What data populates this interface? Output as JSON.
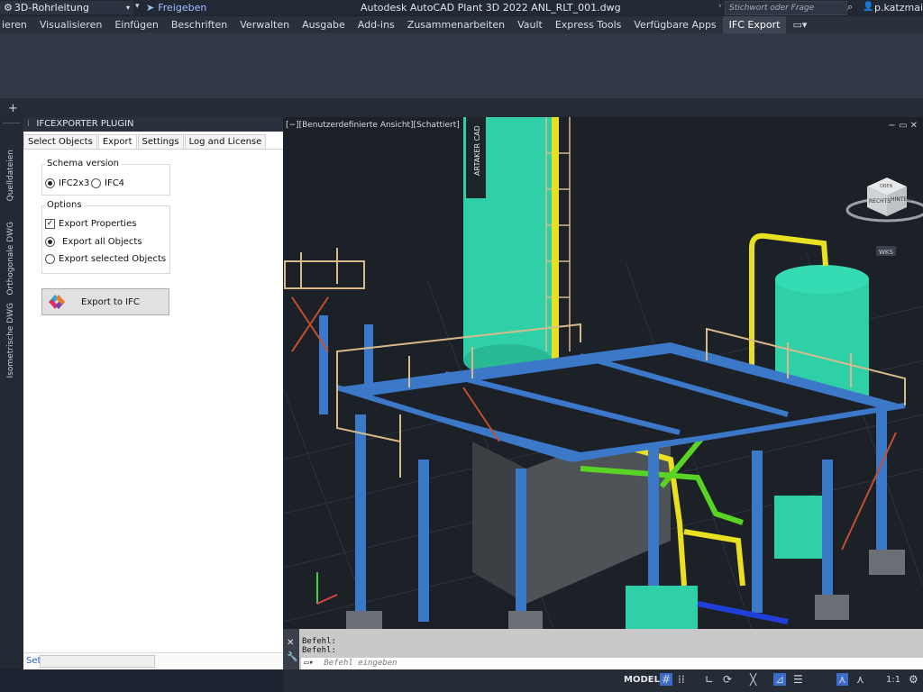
{
  "titlebar": {
    "workspace": "3D-Rohrleitung",
    "share": "Freigeben",
    "app_title": "Autodesk AutoCAD Plant 3D 2022   ANL_RLT_001.dwg",
    "search_placeholder": "Stichwort oder Frage eingeben",
    "user": "p.katzmaier@"
  },
  "ribbon": {
    "tabs": [
      "ieren",
      "Visualisieren",
      "Einfügen",
      "Beschriften",
      "Verwalten",
      "Ausgabe",
      "Add-ins",
      "Zusammenarbeiten",
      "Vault",
      "Express Tools",
      "Verfügbare Apps",
      "IFC Export"
    ],
    "active_tab": "IFC Export"
  },
  "side_tabs": [
    "Quelldateien",
    "Orthogonale DWG",
    "Isometrische DWG"
  ],
  "panel": {
    "title": "IFCEXPORTER PLUGIN",
    "tabs": [
      "Select Objects",
      "Export",
      "Settings",
      "Log and License"
    ],
    "active_tab": "Export",
    "schema_label": "Schema version",
    "schema_options": [
      "IFC2x3",
      "IFC4"
    ],
    "schema_selected": "IFC2x3",
    "options_label": "Options",
    "export_properties": "Export Properties",
    "export_all": "Export all Objects",
    "export_selected": "Export selected Objects",
    "export_button": "Export to IFC",
    "set_link": "Set"
  },
  "viewport": {
    "label": "[−][Benutzerdefinierte Ansicht][Schattiert]",
    "viewcube_left": "RECHTS",
    "viewcube_right": "HINTEN",
    "viewcube_top": "OBEN",
    "wcs": "WKS",
    "column_text": "ARTAKER CAD"
  },
  "command": {
    "lines": [
      "Befehl:",
      "Befehl:"
    ],
    "input_placeholder": "Befehl eingeben"
  },
  "status": {
    "model": "MODELL",
    "scale": "1:1"
  },
  "colors": {
    "vessel": "#2fd0a8",
    "steel": "#3c78c8",
    "pipe_yellow": "#e8e020",
    "pipe_green": "#5ad424",
    "rail": "#d8b98a"
  }
}
